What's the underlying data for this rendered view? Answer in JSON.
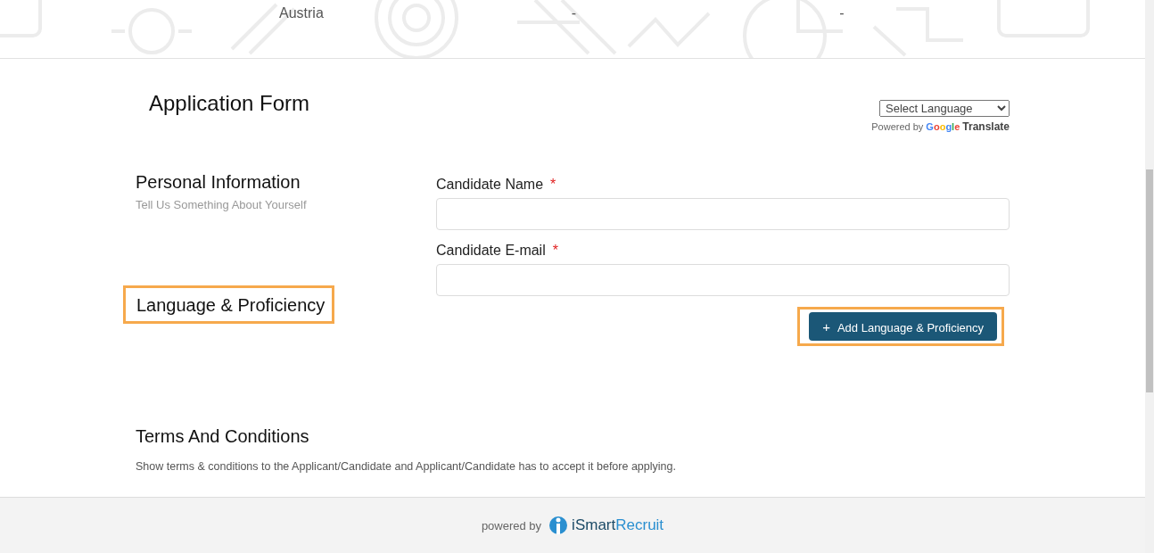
{
  "top_row": {
    "cells": [
      "Austria",
      "-",
      "-"
    ]
  },
  "header": {
    "title": "Application Form",
    "language_select": {
      "value": "Select Language"
    },
    "powered_by": "Powered by",
    "google": "Google",
    "translate": "Translate"
  },
  "sections": [
    {
      "kind": "fields",
      "title": "Personal Information",
      "subtitle": "Tell Us Something About Yourself",
      "highlighted": false,
      "fields": [
        {
          "label": "Candidate Name",
          "required_mark": "*"
        },
        {
          "label": "Candidate E-mail",
          "required_mark": "*"
        }
      ]
    },
    {
      "kind": "button",
      "title": "Language & Proficiency",
      "highlighted": true,
      "button": {
        "icon": "+",
        "label": "Add Language & Proficiency",
        "highlighted": true
      }
    }
  ],
  "terms": {
    "title": "Terms And Conditions",
    "text": "Show terms & conditions to the Applicant/Candidate and Applicant/Candidate has to accept it before applying."
  },
  "footer": {
    "powered_by": "powered by",
    "brand": [
      "iSmart",
      "Recruit"
    ]
  }
}
